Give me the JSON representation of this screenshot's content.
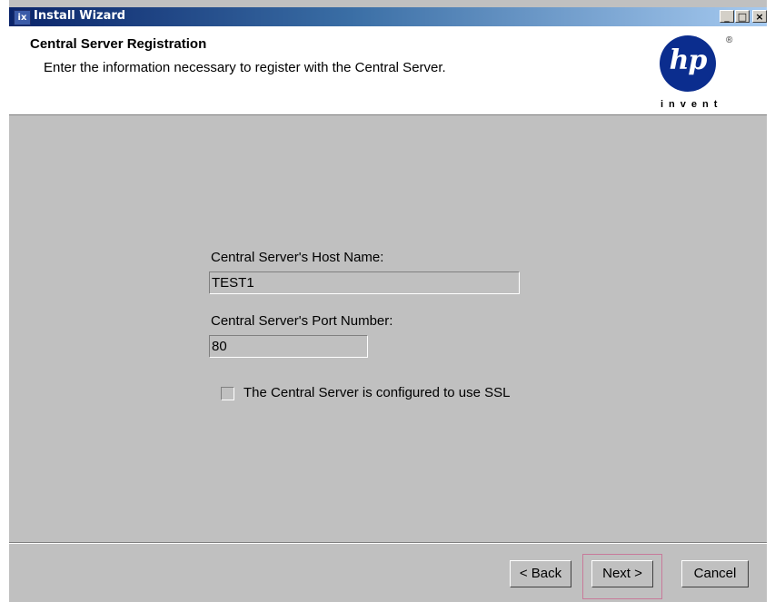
{
  "window": {
    "title": "Install Wizard",
    "app_icon": "ix",
    "controls": {
      "minimize": "_",
      "maximize": "□",
      "close": "×"
    }
  },
  "header": {
    "title": "Central Server Registration",
    "subtitle": "Enter the information necessary to register with the Central Server.",
    "logo_text": "hp",
    "logo_registered": "®",
    "logo_tagline": "invent",
    "logo_color": "#0b2d8e"
  },
  "form": {
    "host_label": "Central Server's Host Name:",
    "host_value": "TEST1",
    "port_label": "Central Server's Port Number:",
    "port_value": "80",
    "ssl_label": "The Central Server is configured to use SSL",
    "ssl_checked": false
  },
  "footer": {
    "back_label": "< Back",
    "next_label": "Next >",
    "cancel_label": "Cancel"
  }
}
